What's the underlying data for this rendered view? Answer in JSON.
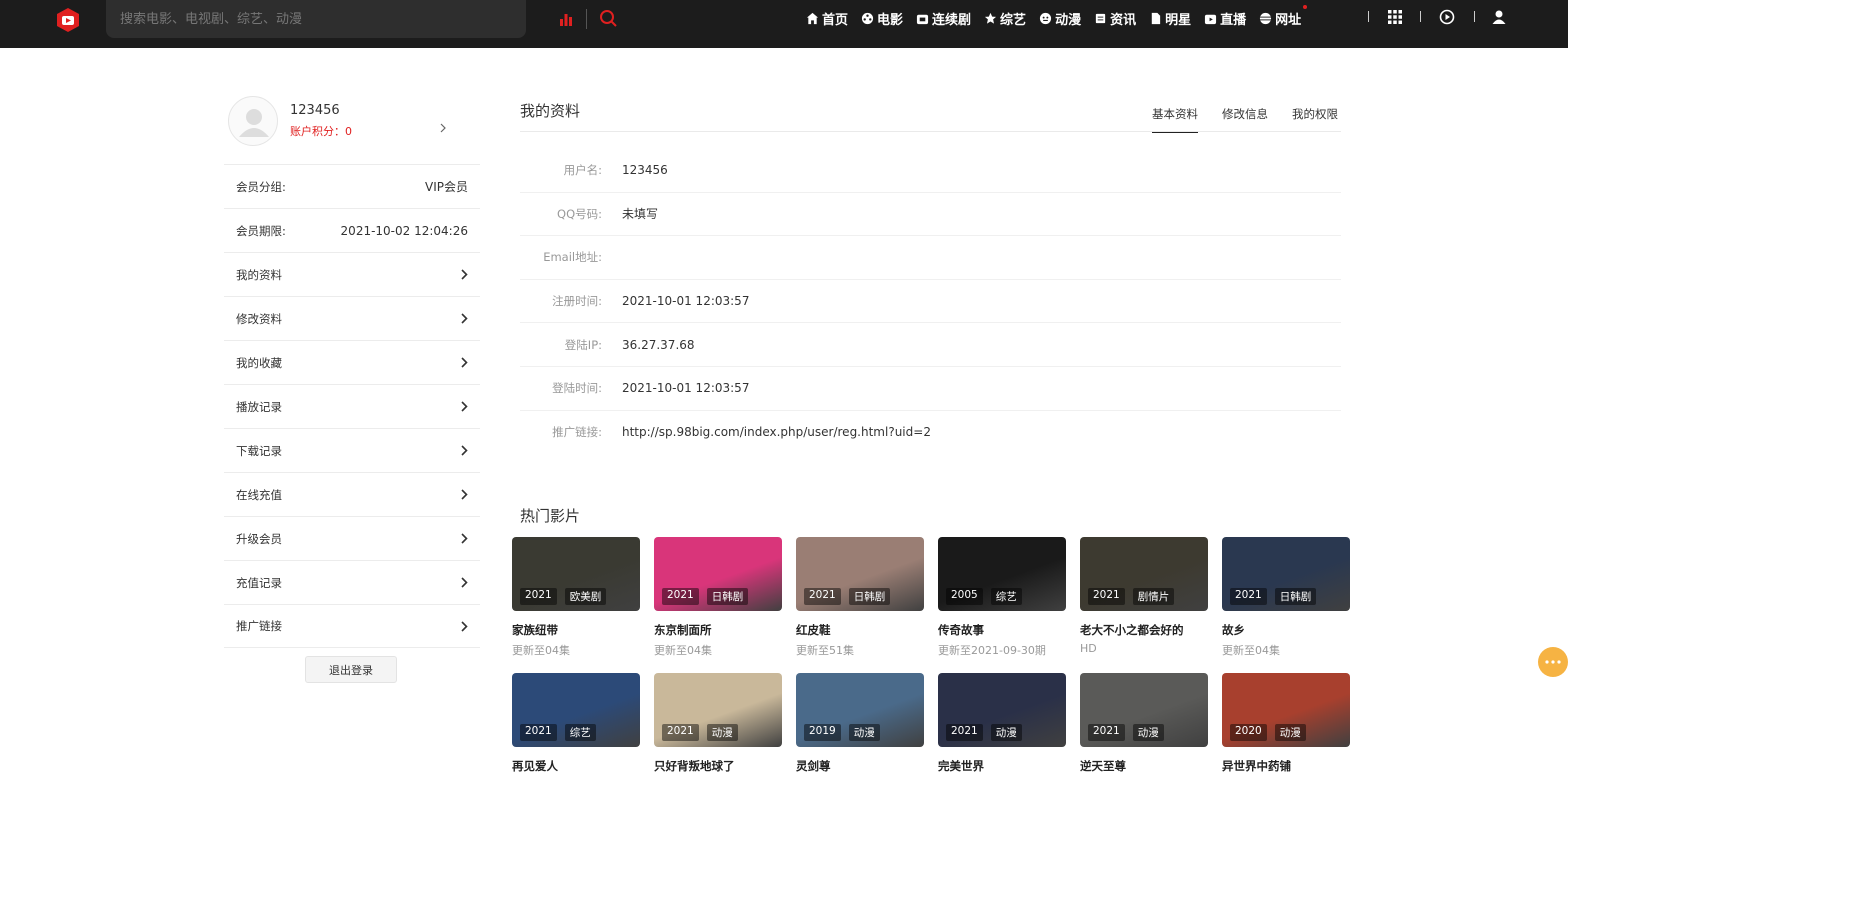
{
  "header": {
    "search_placeholder": "搜索电影、电视剧、综艺、动漫",
    "nav": [
      {
        "label": "首页",
        "icon": "home-icon"
      },
      {
        "label": "电影",
        "icon": "film-reel-icon"
      },
      {
        "label": "连续剧",
        "icon": "tv-icon"
      },
      {
        "label": "综艺",
        "icon": "star-icon"
      },
      {
        "label": "动漫",
        "icon": "face-icon"
      },
      {
        "label": "资讯",
        "icon": "news-icon"
      },
      {
        "label": "明星",
        "icon": "document-icon"
      },
      {
        "label": "直播",
        "icon": "live-tv-icon"
      },
      {
        "label": "网址",
        "icon": "globe-icon"
      }
    ],
    "accent_color": "#e02020"
  },
  "user": {
    "username": "123456",
    "points": "账户积分：0",
    "group_label": "会员分组:",
    "group_value": "VIP会员",
    "expire_label": "会员期限:",
    "expire_value": "2021-10-02 12:04:26"
  },
  "side_menu": [
    "我的资料",
    "修改资料",
    "我的收藏",
    "播放记录",
    "下载记录",
    "在线充值",
    "升级会员",
    "充值记录",
    "推广链接"
  ],
  "logout_label": "退出登录",
  "profile": {
    "title": "我的资料",
    "tabs": [
      "基本资料",
      "修改信息",
      "我的权限"
    ],
    "rows": [
      {
        "label": "用户名:",
        "value": "123456"
      },
      {
        "label": "QQ号码:",
        "value": "未填写"
      },
      {
        "label": "Email地址:",
        "value": ""
      },
      {
        "label": "注册时间:",
        "value": "2021-10-01 12:03:57"
      },
      {
        "label": "登陆IP:",
        "value": "36.27.37.68"
      },
      {
        "label": "登陆时间:",
        "value": "2021-10-01 12:03:57"
      },
      {
        "label": "推广链接:",
        "value": "http://sp.98big.com/index.php/user/reg.html?uid=2"
      }
    ]
  },
  "hot": {
    "title": "热门影片",
    "items": [
      {
        "title": "家族纽带",
        "year": "2021",
        "type": "欧美剧",
        "sub": "更新至04集",
        "color": "#3a3a32"
      },
      {
        "title": "东京制面所",
        "year": "2021",
        "type": "日韩剧",
        "sub": "更新至04集",
        "color": "#d9357a"
      },
      {
        "title": "红皮鞋",
        "year": "2021",
        "type": "日韩剧",
        "sub": "更新至51集",
        "color": "#9a7e74"
      },
      {
        "title": "传奇故事",
        "year": "2005",
        "type": "综艺",
        "sub": "更新至2021-09-30期",
        "color": "#1a1a1a"
      },
      {
        "title": "老大不小之都会好的",
        "year": "2021",
        "type": "剧情片",
        "sub": "HD",
        "color": "#3d3a30"
      },
      {
        "title": "故乡",
        "year": "2021",
        "type": "日韩剧",
        "sub": "更新至04集",
        "color": "#2a3850"
      },
      {
        "title": "再见爱人",
        "year": "2021",
        "type": "综艺",
        "sub": "",
        "color": "#2c4a78"
      },
      {
        "title": "只好背叛地球了",
        "year": "2021",
        "type": "动漫",
        "sub": "",
        "color": "#c9b89a"
      },
      {
        "title": "灵剑尊",
        "year": "2019",
        "type": "动漫",
        "sub": "",
        "color": "#4a6a8a"
      },
      {
        "title": "完美世界",
        "year": "2021",
        "type": "动漫",
        "sub": "",
        "color": "#2a3048"
      },
      {
        "title": "逆天至尊",
        "year": "2021",
        "type": "动漫",
        "sub": "",
        "color": "#5a5a58"
      },
      {
        "title": "异世界中药铺",
        "year": "2020",
        "type": "动漫",
        "sub": "",
        "color": "#a8402e"
      }
    ]
  }
}
